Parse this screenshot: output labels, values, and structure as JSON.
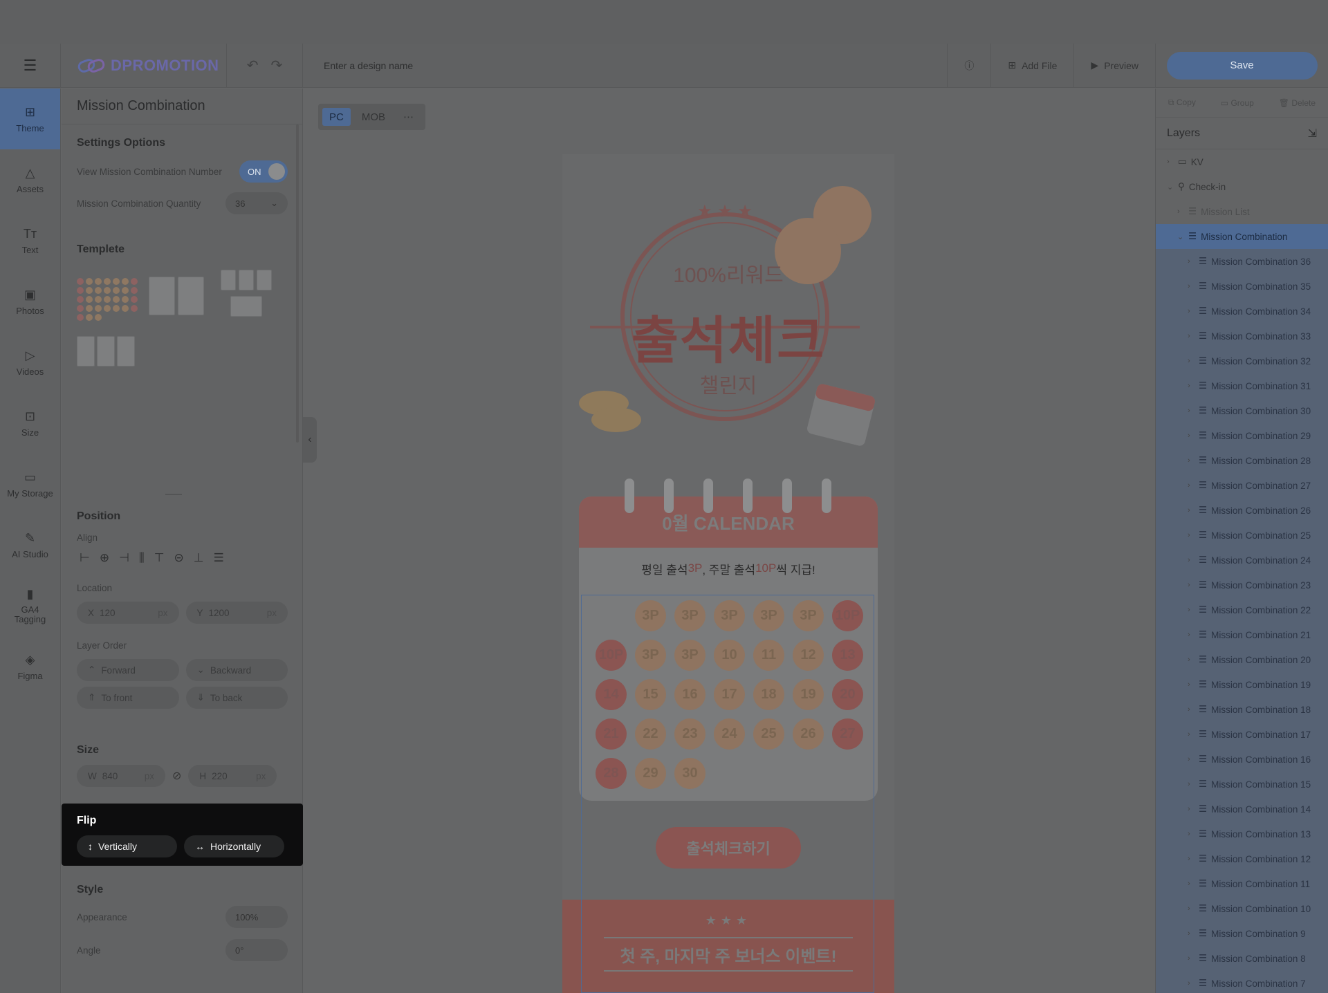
{
  "header": {
    "logo": "DPROMOTION",
    "design_name_placeholder": "Enter a design name",
    "add_file": "Add File",
    "preview": "Preview",
    "save": "Save"
  },
  "nav": [
    {
      "label": "Theme",
      "icon": "theme-icon",
      "glyph": "⊞"
    },
    {
      "label": "Assets",
      "icon": "assets-icon",
      "glyph": "△"
    },
    {
      "label": "Text",
      "icon": "text-icon",
      "glyph": "Tт"
    },
    {
      "label": "Photos",
      "icon": "photo-icon",
      "glyph": "▣"
    },
    {
      "label": "Videos",
      "icon": "video-icon",
      "glyph": "▷"
    },
    {
      "label": "Size",
      "icon": "size-icon",
      "glyph": "⊡"
    },
    {
      "label": "My Storage",
      "icon": "folder-icon",
      "glyph": "▭"
    },
    {
      "label": "AI Studio",
      "icon": "wand-icon",
      "glyph": "✎"
    },
    {
      "label": "GA4 Tagging",
      "icon": "bar-chart-icon",
      "glyph": "▮"
    },
    {
      "label": "Figma",
      "icon": "figma-icon",
      "glyph": "◈"
    }
  ],
  "panel": {
    "title": "Mission Combination",
    "settings_title": "Settings Options",
    "view_number_label": "View Mission Combination Number",
    "toggle_value": "ON",
    "quantity_label": "Mission Combination Quantity",
    "quantity_value": "36",
    "template_title": "Templete",
    "position_title": "Position",
    "align_label": "Align",
    "location_label": "Location",
    "x_label": "X",
    "x_value": "120",
    "y_label": "Y",
    "y_value": "1200",
    "unit": "px",
    "layer_order_label": "Layer Order",
    "forward": "Forward",
    "backward": "Backward",
    "to_front": "To front",
    "to_back": "To back",
    "size_title": "Size",
    "w_label": "W",
    "w_value": "840",
    "h_label": "H",
    "h_value": "220",
    "flip_title": "Flip",
    "vertically": "Vertically",
    "horizontally": "Horizontally",
    "style_title": "Style",
    "appearance_label": "Appearance",
    "appearance_value": "100%",
    "angle_label": "Angle",
    "angle_value": "0°"
  },
  "devices": [
    "PC",
    "MOB"
  ],
  "canvas": {
    "kv_reward": "100%리워드",
    "kv_title": "출석체크",
    "kv_sub": "챌린지",
    "calendar_title": "0월 CALENDAR",
    "calendar_sub_a": "평일 출석 ",
    "calendar_sub_b": "3P",
    "calendar_sub_c": ", 주말 출석 ",
    "calendar_sub_d": "10P",
    "calendar_sub_e": "씩 지급!",
    "coins": [
      "",
      "3P",
      "3P",
      "3P",
      "3P",
      "3P",
      "10P",
      "10P",
      "3P",
      "3P",
      "10",
      "11",
      "12",
      "13",
      "14",
      "15",
      "16",
      "17",
      "18",
      "19",
      "20",
      "21",
      "22",
      "23",
      "24",
      "25",
      "26",
      "27",
      "28",
      "29",
      "30"
    ],
    "cta": "출석체크하기",
    "bonus_stars": "★★★",
    "bonus_title": "첫 주, 마지막 주 보너스 이벤트!"
  },
  "right": {
    "copy": "Copy",
    "group": "Group",
    "delete": "Delete",
    "layers_title": "Layers",
    "layers": [
      {
        "name": "KV",
        "depth": 0,
        "state": "normal"
      },
      {
        "name": "Check-in",
        "depth": 0,
        "state": "normal"
      },
      {
        "name": "Mission List",
        "depth": 1,
        "state": "dim"
      },
      {
        "name": "Mission Combination",
        "depth": 1,
        "state": "sel"
      },
      {
        "name": "Mission Combination 36",
        "depth": 2,
        "state": "child"
      },
      {
        "name": "Mission Combination 35",
        "depth": 2,
        "state": "child"
      },
      {
        "name": "Mission Combination 34",
        "depth": 2,
        "state": "child"
      },
      {
        "name": "Mission Combination 33",
        "depth": 2,
        "state": "child"
      },
      {
        "name": "Mission Combination 32",
        "depth": 2,
        "state": "child"
      },
      {
        "name": "Mission Combination 31",
        "depth": 2,
        "state": "child"
      },
      {
        "name": "Mission Combination 30",
        "depth": 2,
        "state": "child"
      },
      {
        "name": "Mission Combination 29",
        "depth": 2,
        "state": "child"
      },
      {
        "name": "Mission Combination 28",
        "depth": 2,
        "state": "child"
      },
      {
        "name": "Mission Combination 27",
        "depth": 2,
        "state": "child"
      },
      {
        "name": "Mission Combination 26",
        "depth": 2,
        "state": "child"
      },
      {
        "name": "Mission Combination 25",
        "depth": 2,
        "state": "child"
      },
      {
        "name": "Mission Combination 24",
        "depth": 2,
        "state": "child"
      },
      {
        "name": "Mission Combination 23",
        "depth": 2,
        "state": "child"
      },
      {
        "name": "Mission Combination 22",
        "depth": 2,
        "state": "child"
      },
      {
        "name": "Mission Combination 21",
        "depth": 2,
        "state": "child"
      },
      {
        "name": "Mission Combination 20",
        "depth": 2,
        "state": "child"
      },
      {
        "name": "Mission Combination 19",
        "depth": 2,
        "state": "child"
      },
      {
        "name": "Mission Combination 18",
        "depth": 2,
        "state": "child"
      },
      {
        "name": "Mission Combination 17",
        "depth": 2,
        "state": "child"
      },
      {
        "name": "Mission Combination 16",
        "depth": 2,
        "state": "child"
      },
      {
        "name": "Mission Combination 15",
        "depth": 2,
        "state": "child"
      },
      {
        "name": "Mission Combination 14",
        "depth": 2,
        "state": "child"
      },
      {
        "name": "Mission Combination 13",
        "depth": 2,
        "state": "child"
      },
      {
        "name": "Mission Combination 12",
        "depth": 2,
        "state": "child"
      },
      {
        "name": "Mission Combination 11",
        "depth": 2,
        "state": "child"
      },
      {
        "name": "Mission Combination 10",
        "depth": 2,
        "state": "child"
      },
      {
        "name": "Mission Combination 9",
        "depth": 2,
        "state": "child"
      },
      {
        "name": "Mission Combination 8",
        "depth": 2,
        "state": "child"
      },
      {
        "name": "Mission Combination 7",
        "depth": 2,
        "state": "child"
      }
    ]
  },
  "colors": {
    "accent": "#4e6a94",
    "overlay_bg": "#656667",
    "flip_bg": "#0d0d0e"
  }
}
